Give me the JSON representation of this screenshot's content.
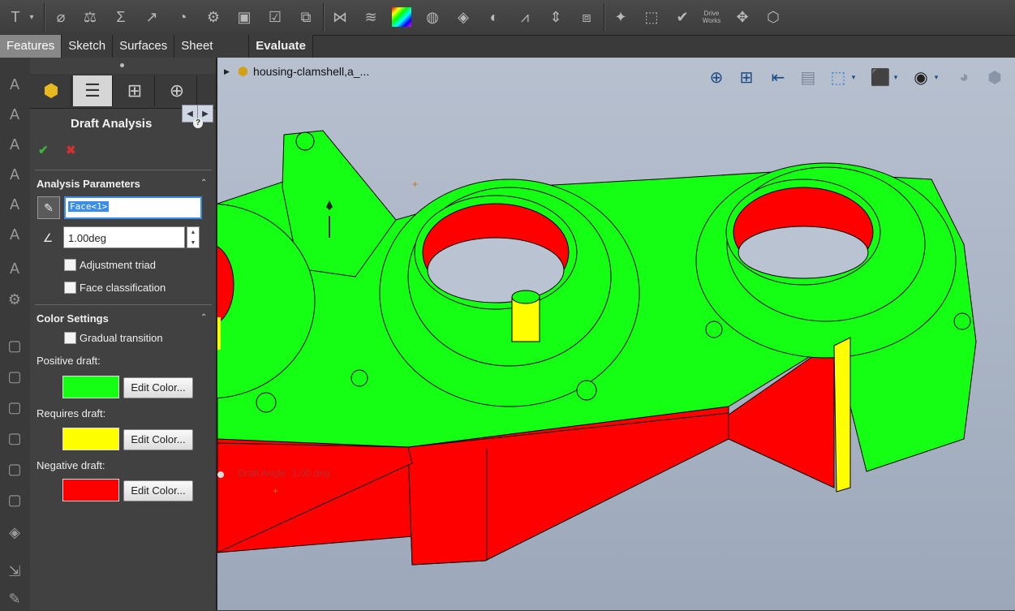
{
  "command_tabs": [
    "Features",
    "Sketch",
    "Surfaces",
    "Sheet Metal",
    "Evaluate"
  ],
  "toolbar_icons": [
    "text-icon",
    "chevron-down-icon",
    "measure-icon",
    "mass-properties-icon",
    "sigma-icon",
    "sensor-icon",
    "performance-evaluation-icon",
    "check-icon",
    "interference-icon",
    "geometry-analysis-icon",
    "import-diagnostics-icon",
    "deviation-icon",
    "zebra-stripes-icon",
    "curvature-icon",
    "undercut-icon",
    "thickness-icon",
    "symmetry-icon",
    "draft-analysis-icon",
    "compare-icon",
    "check-active-icon",
    "costing-icon",
    "driveworks-icon",
    "simulation-icon"
  ],
  "toolbar_text": {
    "driveworks": "Drive Works"
  },
  "property_manager": {
    "title": "Draft Analysis",
    "help": "?",
    "ok_icon": "✔",
    "cancel_icon": "✖",
    "analysis_parameters": {
      "title": "Analysis Parameters",
      "selection": "Face<1>",
      "angle": "1.00deg",
      "adjustment_triad": "Adjustment triad",
      "face_classification": "Face classification"
    },
    "color_settings": {
      "title": "Color Settings",
      "gradual_transition": "Gradual transition",
      "positive_label": "Positive draft:",
      "requires_label": "Requires draft:",
      "negative_label": "Negative draft:",
      "edit_color": "Edit Color...",
      "positive_color": "#14ff14",
      "requires_color": "#ffff00",
      "negative_color": "#ff0000"
    }
  },
  "tree": {
    "part_name": "housing-clamshell,a_..."
  },
  "viewport": {
    "draft_angle_label": "Draft Angle -1.00 deg",
    "model_colors": {
      "positive": "#14ff14",
      "requires": "#ffff00",
      "negative": "#ff0000"
    }
  }
}
